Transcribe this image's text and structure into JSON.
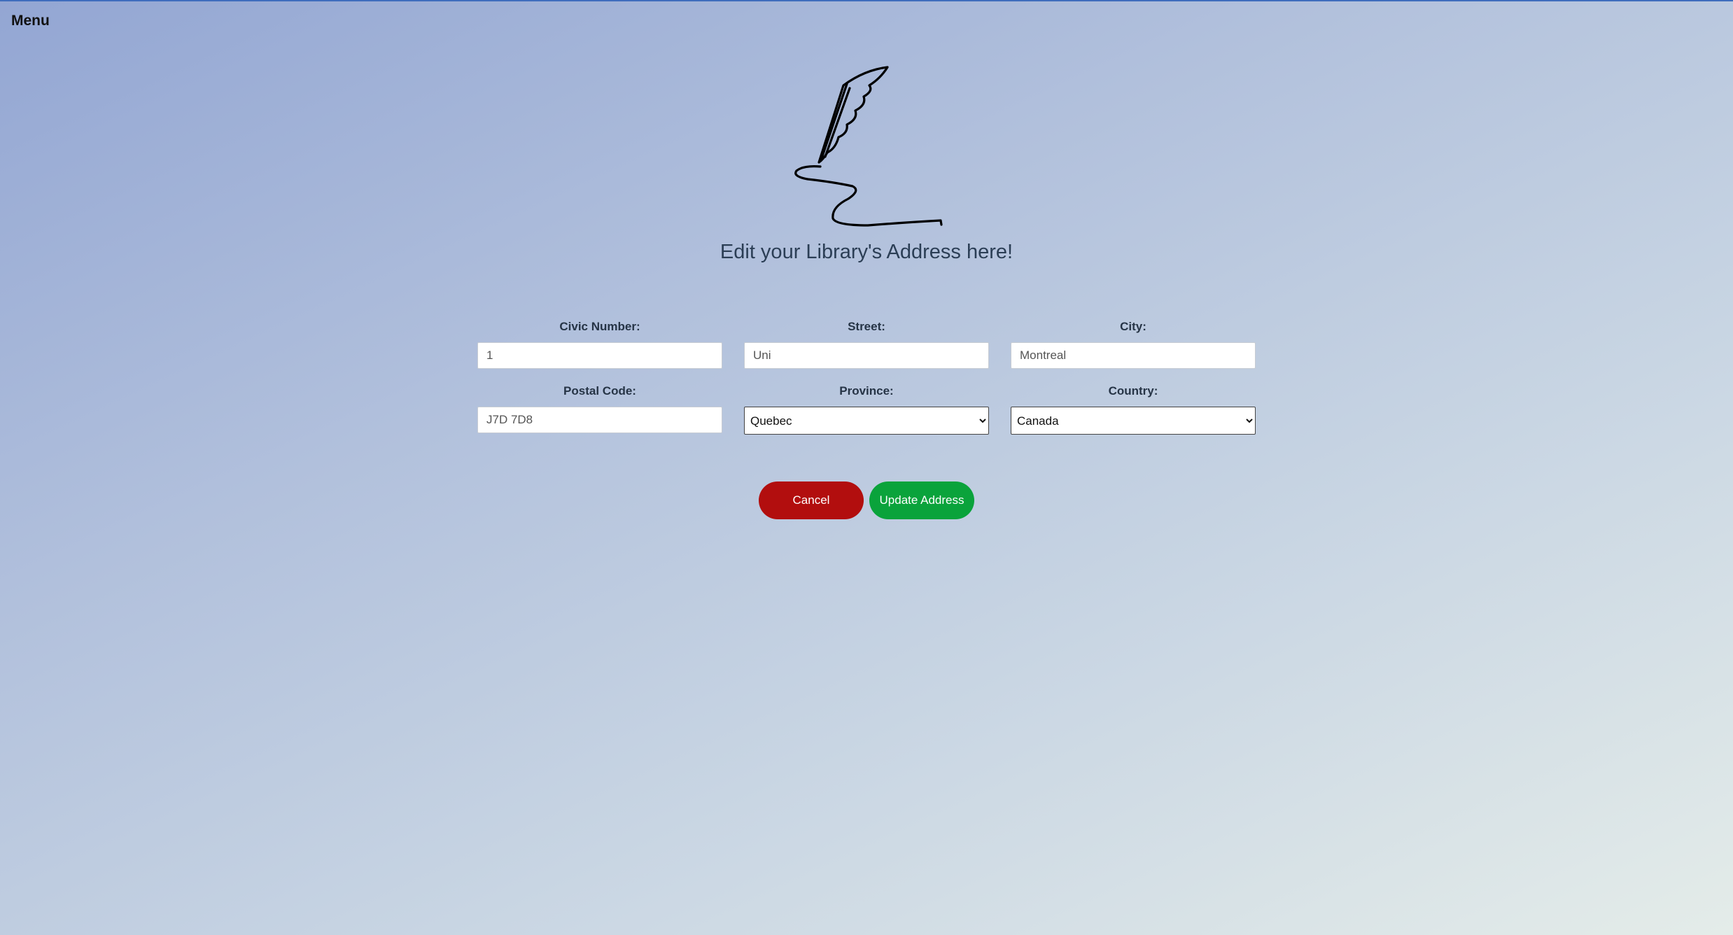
{
  "nav": {
    "menu_label": "Menu"
  },
  "logo": {
    "icon": "quill-pen-icon"
  },
  "heading": "Edit your Library's Address here!",
  "form": {
    "civic_number": {
      "label": "Civic Number:",
      "value": "1"
    },
    "street": {
      "label": "Street:",
      "value": "Uni"
    },
    "city": {
      "label": "City:",
      "value": "Montreal"
    },
    "postal_code": {
      "label": "Postal Code:",
      "value": "J7D 7D8"
    },
    "province": {
      "label": "Province:",
      "selected": "Quebec"
    },
    "country": {
      "label": "Country:",
      "selected": "Canada"
    }
  },
  "actions": {
    "cancel_label": "Cancel",
    "update_label": "Update Address"
  },
  "colors": {
    "cancel": "#b20e0e",
    "update": "#0aa33b",
    "top_border": "#3f6dbd"
  }
}
